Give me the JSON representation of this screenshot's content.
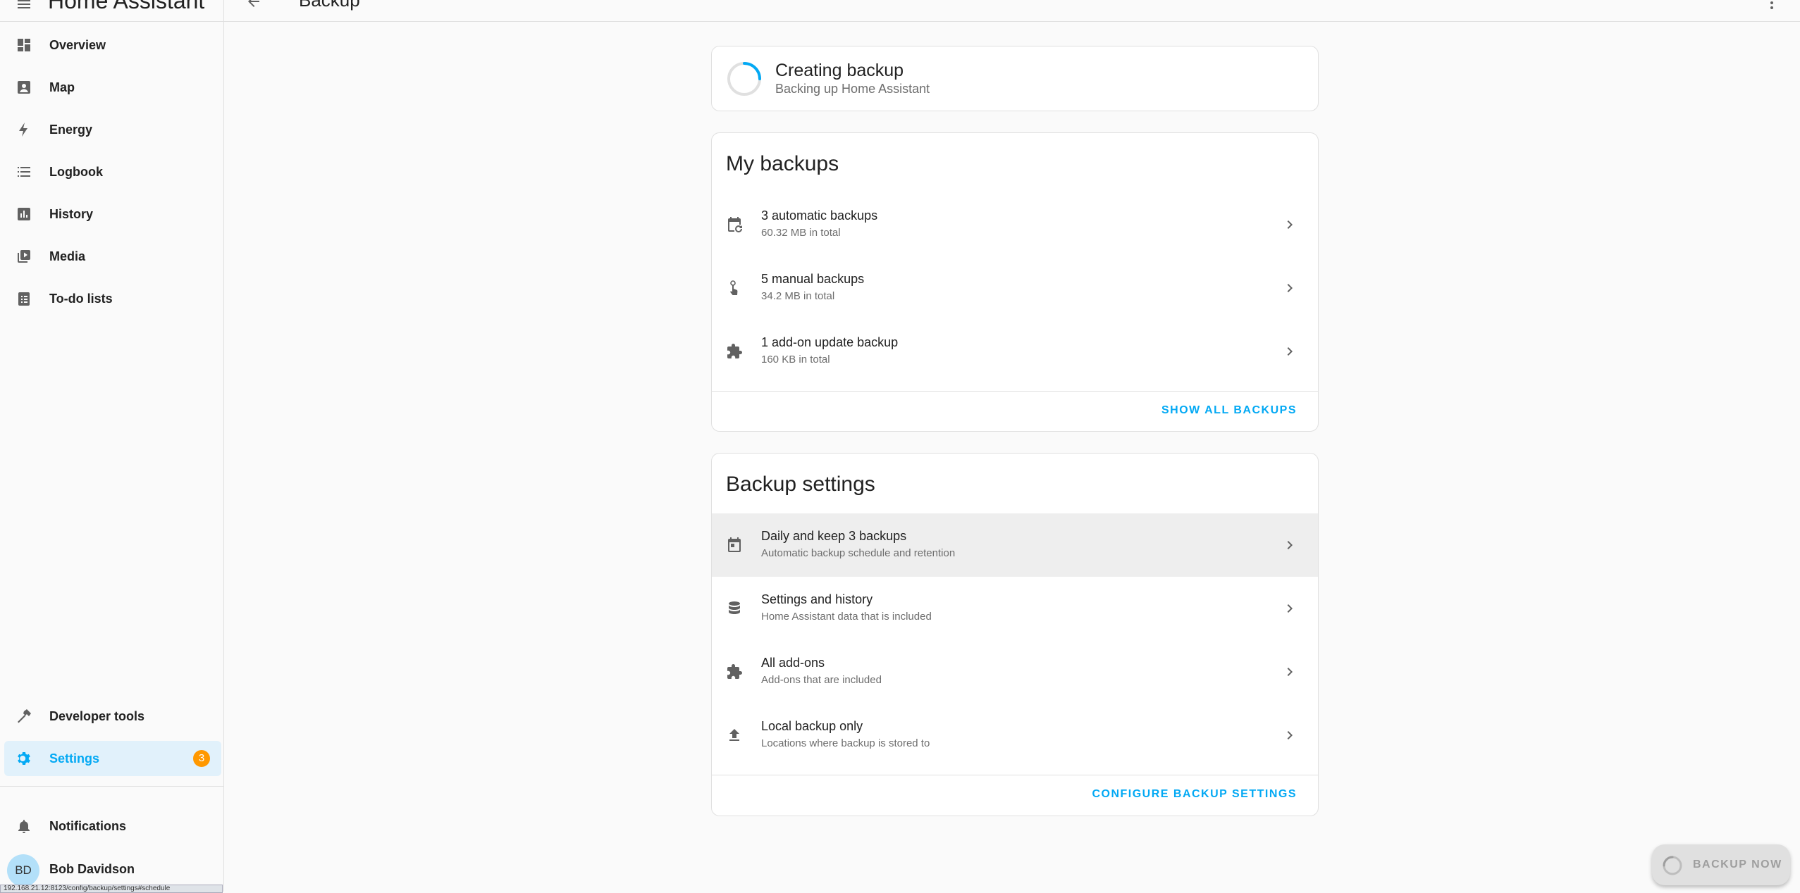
{
  "app": {
    "title": "Home Assistant"
  },
  "page": {
    "title": "Backup"
  },
  "sidebar": {
    "items": [
      {
        "label": "Overview"
      },
      {
        "label": "Map"
      },
      {
        "label": "Energy"
      },
      {
        "label": "Logbook"
      },
      {
        "label": "History"
      },
      {
        "label": "Media"
      },
      {
        "label": "To-do lists"
      }
    ],
    "developer_tools": "Developer tools",
    "settings": "Settings",
    "settings_badge": "3",
    "notifications": "Notifications",
    "user": {
      "initials": "BD",
      "name": "Bob Davidson"
    },
    "status_url": "192.168.21.12:8123/config/backup/settings#schedule"
  },
  "progress": {
    "title": "Creating backup",
    "subtitle": "Backing up Home Assistant"
  },
  "my_backups": {
    "title": "My backups",
    "rows": [
      {
        "primary": "3 automatic backups",
        "secondary": "60.32 MB in total",
        "icon": "calendar-sync-icon"
      },
      {
        "primary": "5 manual backups",
        "secondary": "34.2 MB in total",
        "icon": "gesture-tap-icon"
      },
      {
        "primary": "1 add-on update backup",
        "secondary": "160 KB in total",
        "icon": "puzzle-icon"
      }
    ],
    "action": "SHOW ALL BACKUPS"
  },
  "backup_settings": {
    "title": "Backup settings",
    "rows": [
      {
        "primary": "Daily and keep 3 backups",
        "secondary": "Automatic backup schedule and retention",
        "icon": "calendar-icon"
      },
      {
        "primary": "Settings and history",
        "secondary": "Home Assistant data that is included",
        "icon": "database-icon"
      },
      {
        "primary": "All add-ons",
        "secondary": "Add-ons that are included",
        "icon": "puzzle-icon"
      },
      {
        "primary": "Local backup only",
        "secondary": "Locations where backup is stored to",
        "icon": "upload-icon"
      }
    ],
    "action": "CONFIGURE BACKUP SETTINGS"
  },
  "fab": {
    "label": "BACKUP NOW"
  },
  "colors": {
    "accent": "#03a9f4",
    "badge": "#ff9800",
    "sidebar_active_bg": "#e1f1fb"
  }
}
